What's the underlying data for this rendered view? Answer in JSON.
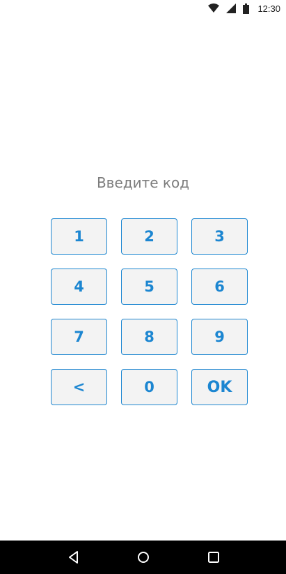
{
  "status_bar": {
    "time": "12:30",
    "icons": [
      "wifi-icon",
      "cell-signal-icon",
      "battery-icon"
    ]
  },
  "prompt": "Введите код",
  "keypad": {
    "keys": [
      "1",
      "2",
      "3",
      "4",
      "5",
      "6",
      "7",
      "8",
      "9",
      "<",
      "0",
      "OK"
    ]
  },
  "nav_bar": {
    "icons": [
      "back-icon",
      "home-icon",
      "recents-icon"
    ]
  },
  "colors": {
    "accent": "#1c86d1",
    "key_background": "#f3f3f3",
    "prompt_text": "#7d7d7d",
    "nav_bar": "#000000"
  }
}
